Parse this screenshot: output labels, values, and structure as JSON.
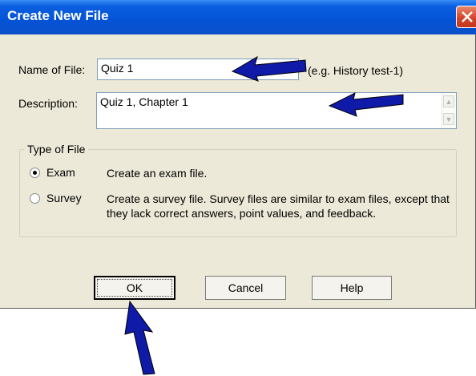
{
  "dialog": {
    "title": "Create New File",
    "name_label": "Name of File:",
    "name_value": "Quiz 1",
    "name_hint": "(e.g. History test-1)",
    "description_label": "Description:",
    "description_value": "Quiz 1, Chapter 1",
    "type_group_label": "Type of File",
    "options": [
      {
        "label": "Exam",
        "description": "Create an exam file.",
        "selected": true
      },
      {
        "label": "Survey",
        "description_line1": "Create a survey file.  Survey files are similar to exam files, except that",
        "description_line2": "they lack correct answers, point values, and feedback.",
        "selected": false
      }
    ],
    "buttons": {
      "ok": "OK",
      "cancel": "Cancel",
      "help": "Help"
    }
  },
  "colors": {
    "titlebar": "#0453d6",
    "dialog_bg": "#ece9d8",
    "arrow": "#0f1aa8"
  },
  "icons": [
    "close-icon",
    "radio-selected",
    "radio-unselected",
    "scroll-up-icon",
    "scroll-down-icon",
    "annotation-arrow"
  ]
}
